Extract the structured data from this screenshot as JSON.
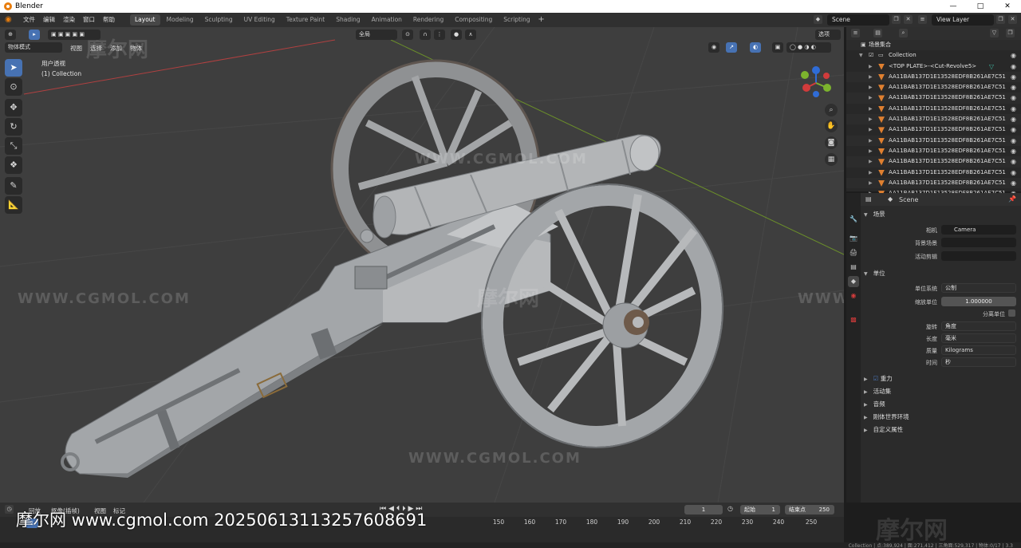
{
  "window": {
    "title": "Blender",
    "controls": [
      "—",
      "□",
      "✕"
    ]
  },
  "menu": [
    "文件",
    "编辑",
    "渲染",
    "窗口",
    "帮助"
  ],
  "workspaces": [
    "Layout",
    "Modeling",
    "Sculpting",
    "UV Editing",
    "Texture Paint",
    "Shading",
    "Animation",
    "Rendering",
    "Compositing",
    "Scripting"
  ],
  "active_workspace": "Layout",
  "scene_name": "Scene",
  "view_layer": "View Layer",
  "viewport": {
    "mode": "物体模式",
    "menus": [
      "视图",
      "选择",
      "添加",
      "物体"
    ],
    "transform_orientation": "全局",
    "options_label": "选项",
    "view_name": "用户透视",
    "collection_info": "(1) Collection"
  },
  "watermarks": {
    "cn": "摩尔网",
    "url": "WWW.CGMOL.COM"
  },
  "outliner": {
    "root": "场景集合",
    "collection": "Collection",
    "rows": [
      "<TOP PLATE>-<Cut-Revolve5>",
      "AA11BAB137D1E13528EDF8B261AE7C51",
      "AA11BAB137D1E13528EDF8B261AE7C51",
      "AA11BAB137D1E13528EDF8B261AE7C51",
      "AA11BAB137D1E13528EDF8B261AE7C51",
      "AA11BAB137D1E13528EDF8B261AE7C51",
      "AA11BAB137D1E13528EDF8B261AE7C51",
      "AA11BAB137D1E13528EDF8B261AE7C51",
      "AA11BAB137D1E13528EDF8B261AE7C51",
      "AA11BAB137D1E13528EDF8B261AE7C51",
      "AA11BAB137D1E13528EDF8B261AE7C51",
      "AA11BAB137D1E13528EDF8B261AE7C51",
      "AA11BAB137D1E13528EDF8B261AE7C51"
    ]
  },
  "properties": {
    "context": "Scene",
    "scene_panel": {
      "title": "场景",
      "camera_label": "相机",
      "camera_value": "Camera",
      "background_label": "背景场景",
      "clip_label": "活动剪辑"
    },
    "units_panel": {
      "title": "单位",
      "system_label": "单位系统",
      "system_value": "公制",
      "scale_label": "缩放单位",
      "scale_value": "1.000000",
      "separate_label": "分离单位",
      "rotation_label": "旋转",
      "rotation_value": "角度",
      "length_label": "长度",
      "length_value": "毫米",
      "mass_label": "质量",
      "mass_value": "Kilograms",
      "time_label": "时间",
      "time_value": "秒"
    },
    "collapsed_panels": [
      "重力",
      "活动集",
      "音频",
      "刚体世界环境",
      "自定义属性"
    ]
  },
  "timeline": {
    "menus": [
      "回放",
      "抠像(插帧)",
      "视图",
      "标记"
    ],
    "current_frame": "1",
    "start_label": "起始",
    "start_value": "1",
    "end_label": "结束点",
    "end_value": "250",
    "ticks": [
      "1",
      "150",
      "160",
      "170",
      "180",
      "190",
      "200",
      "210",
      "220",
      "230",
      "240",
      "250"
    ]
  },
  "stamp": "摩尔网 www.cgmol.com 20250613113257608691",
  "status": {
    "right": "Collection | 点:389,924 | 面:271,412 | 三角面:529,317 | 物体:0/17 | 3.3"
  },
  "colors": {
    "accent": "#4772b3",
    "blender_orange": "#e87d0d",
    "viewport_bg": "#3e3e3e",
    "model_gray": "#a9abad"
  }
}
